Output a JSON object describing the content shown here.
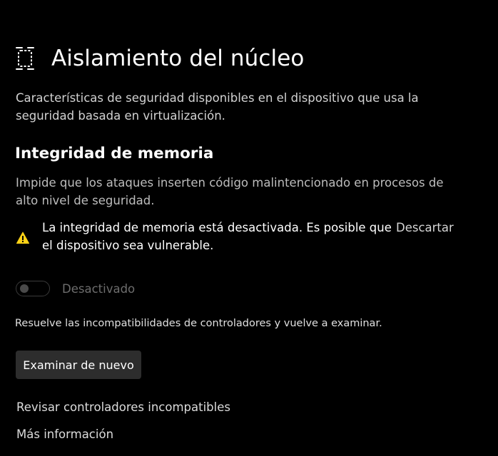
{
  "header": {
    "title": "Aislamiento del núcleo",
    "icon": "core-isolation-icon"
  },
  "intro": {
    "text": "Características de seguridad disponibles en el dispositivo que usa la seguridad basada en virtualización."
  },
  "memory_integrity": {
    "heading": "Integridad de memoria",
    "description": "Impide que los ataques inserten código malintencionado en procesos de alto nivel de seguridad.",
    "warning": {
      "icon": "warning-icon",
      "color": "#fcd116",
      "text": "La integridad de memoria está desactivada. Es posible que el dispositivo sea vulnerable.",
      "dismiss_label": "Descartar"
    },
    "toggle": {
      "state": "off",
      "disabled": true,
      "label": "Desactivado"
    },
    "note": "Resuelve las incompatibilidades de controladores y vuelve a examinar.",
    "rescan_label": "Examinar de nuevo"
  },
  "links": {
    "review_drivers": "Revisar controladores incompatibles",
    "more_info": "Más información"
  }
}
